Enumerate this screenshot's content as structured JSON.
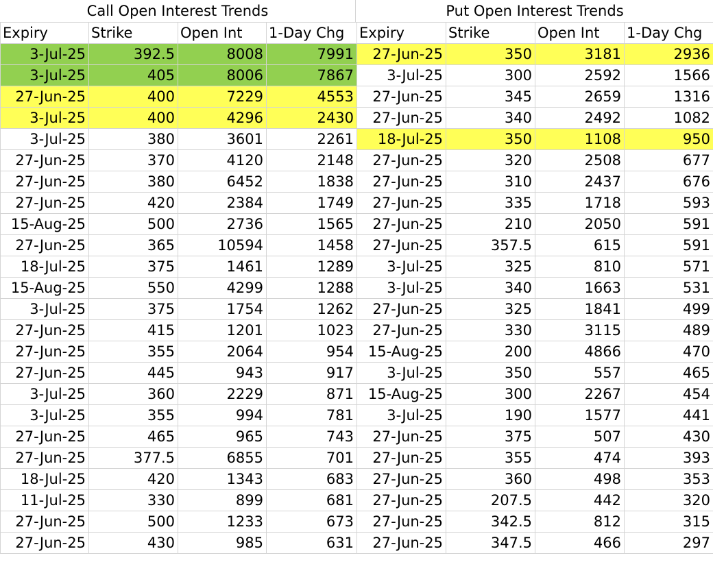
{
  "calls": {
    "title": "Call Open Interest Trends",
    "headers": [
      "Expiry",
      "Strike",
      "Open Int",
      "1-Day Chg"
    ],
    "rows": [
      {
        "expiry": "3-Jul-25",
        "strike": "392.5",
        "oi": "8008",
        "chg": "7991",
        "highlight": "green"
      },
      {
        "expiry": "3-Jul-25",
        "strike": "405",
        "oi": "8006",
        "chg": "7867",
        "highlight": "green"
      },
      {
        "expiry": "27-Jun-25",
        "strike": "400",
        "oi": "7229",
        "chg": "4553",
        "highlight": "yellow"
      },
      {
        "expiry": "3-Jul-25",
        "strike": "400",
        "oi": "4296",
        "chg": "2430",
        "highlight": "yellow"
      },
      {
        "expiry": "3-Jul-25",
        "strike": "380",
        "oi": "3601",
        "chg": "2261",
        "highlight": ""
      },
      {
        "expiry": "27-Jun-25",
        "strike": "370",
        "oi": "4120",
        "chg": "2148",
        "highlight": ""
      },
      {
        "expiry": "27-Jun-25",
        "strike": "380",
        "oi": "6452",
        "chg": "1838",
        "highlight": ""
      },
      {
        "expiry": "27-Jun-25",
        "strike": "420",
        "oi": "2384",
        "chg": "1749",
        "highlight": ""
      },
      {
        "expiry": "15-Aug-25",
        "strike": "500",
        "oi": "2736",
        "chg": "1565",
        "highlight": ""
      },
      {
        "expiry": "27-Jun-25",
        "strike": "365",
        "oi": "10594",
        "chg": "1458",
        "highlight": ""
      },
      {
        "expiry": "18-Jul-25",
        "strike": "375",
        "oi": "1461",
        "chg": "1289",
        "highlight": ""
      },
      {
        "expiry": "15-Aug-25",
        "strike": "550",
        "oi": "4299",
        "chg": "1288",
        "highlight": ""
      },
      {
        "expiry": "3-Jul-25",
        "strike": "375",
        "oi": "1754",
        "chg": "1262",
        "highlight": ""
      },
      {
        "expiry": "27-Jun-25",
        "strike": "415",
        "oi": "1201",
        "chg": "1023",
        "highlight": ""
      },
      {
        "expiry": "27-Jun-25",
        "strike": "355",
        "oi": "2064",
        "chg": "954",
        "highlight": ""
      },
      {
        "expiry": "27-Jun-25",
        "strike": "445",
        "oi": "943",
        "chg": "917",
        "highlight": ""
      },
      {
        "expiry": "3-Jul-25",
        "strike": "360",
        "oi": "2229",
        "chg": "871",
        "highlight": ""
      },
      {
        "expiry": "3-Jul-25",
        "strike": "355",
        "oi": "994",
        "chg": "781",
        "highlight": ""
      },
      {
        "expiry": "27-Jun-25",
        "strike": "465",
        "oi": "965",
        "chg": "743",
        "highlight": ""
      },
      {
        "expiry": "27-Jun-25",
        "strike": "377.5",
        "oi": "6855",
        "chg": "701",
        "highlight": ""
      },
      {
        "expiry": "18-Jul-25",
        "strike": "420",
        "oi": "1343",
        "chg": "683",
        "highlight": ""
      },
      {
        "expiry": "11-Jul-25",
        "strike": "330",
        "oi": "899",
        "chg": "681",
        "highlight": ""
      },
      {
        "expiry": "27-Jun-25",
        "strike": "500",
        "oi": "1233",
        "chg": "673",
        "highlight": ""
      },
      {
        "expiry": "27-Jun-25",
        "strike": "430",
        "oi": "985",
        "chg": "631",
        "highlight": ""
      }
    ]
  },
  "puts": {
    "title": "Put Open Interest Trends",
    "headers": [
      "Expiry",
      "Strike",
      "Open Int",
      "1-Day Chg"
    ],
    "rows": [
      {
        "expiry": "27-Jun-25",
        "strike": "350",
        "oi": "3181",
        "chg": "2936",
        "highlight": "yellow"
      },
      {
        "expiry": "3-Jul-25",
        "strike": "300",
        "oi": "2592",
        "chg": "1566",
        "highlight": ""
      },
      {
        "expiry": "27-Jun-25",
        "strike": "345",
        "oi": "2659",
        "chg": "1316",
        "highlight": ""
      },
      {
        "expiry": "27-Jun-25",
        "strike": "340",
        "oi": "2492",
        "chg": "1082",
        "highlight": ""
      },
      {
        "expiry": "18-Jul-25",
        "strike": "350",
        "oi": "1108",
        "chg": "950",
        "highlight": "yellow"
      },
      {
        "expiry": "27-Jun-25",
        "strike": "320",
        "oi": "2508",
        "chg": "677",
        "highlight": ""
      },
      {
        "expiry": "27-Jun-25",
        "strike": "310",
        "oi": "2437",
        "chg": "676",
        "highlight": ""
      },
      {
        "expiry": "27-Jun-25",
        "strike": "335",
        "oi": "1718",
        "chg": "593",
        "highlight": ""
      },
      {
        "expiry": "27-Jun-25",
        "strike": "210",
        "oi": "2050",
        "chg": "591",
        "highlight": ""
      },
      {
        "expiry": "27-Jun-25",
        "strike": "357.5",
        "oi": "615",
        "chg": "591",
        "highlight": ""
      },
      {
        "expiry": "3-Jul-25",
        "strike": "325",
        "oi": "810",
        "chg": "571",
        "highlight": ""
      },
      {
        "expiry": "3-Jul-25",
        "strike": "340",
        "oi": "1663",
        "chg": "531",
        "highlight": ""
      },
      {
        "expiry": "27-Jun-25",
        "strike": "325",
        "oi": "1841",
        "chg": "499",
        "highlight": ""
      },
      {
        "expiry": "27-Jun-25",
        "strike": "330",
        "oi": "3115",
        "chg": "489",
        "highlight": ""
      },
      {
        "expiry": "15-Aug-25",
        "strike": "200",
        "oi": "4866",
        "chg": "470",
        "highlight": ""
      },
      {
        "expiry": "3-Jul-25",
        "strike": "350",
        "oi": "557",
        "chg": "465",
        "highlight": ""
      },
      {
        "expiry": "15-Aug-25",
        "strike": "300",
        "oi": "2267",
        "chg": "454",
        "highlight": ""
      },
      {
        "expiry": "3-Jul-25",
        "strike": "190",
        "oi": "1577",
        "chg": "441",
        "highlight": ""
      },
      {
        "expiry": "27-Jun-25",
        "strike": "375",
        "oi": "507",
        "chg": "430",
        "highlight": ""
      },
      {
        "expiry": "27-Jun-25",
        "strike": "355",
        "oi": "474",
        "chg": "393",
        "highlight": ""
      },
      {
        "expiry": "27-Jun-25",
        "strike": "360",
        "oi": "498",
        "chg": "353",
        "highlight": ""
      },
      {
        "expiry": "27-Jun-25",
        "strike": "207.5",
        "oi": "442",
        "chg": "320",
        "highlight": ""
      },
      {
        "expiry": "27-Jun-25",
        "strike": "342.5",
        "oi": "812",
        "chg": "315",
        "highlight": ""
      },
      {
        "expiry": "27-Jun-25",
        "strike": "347.5",
        "oi": "466",
        "chg": "297",
        "highlight": ""
      }
    ]
  },
  "colors": {
    "green_highlight": "#92d050",
    "yellow_highlight": "#ffff57",
    "gridline": "#d4d4d4"
  }
}
